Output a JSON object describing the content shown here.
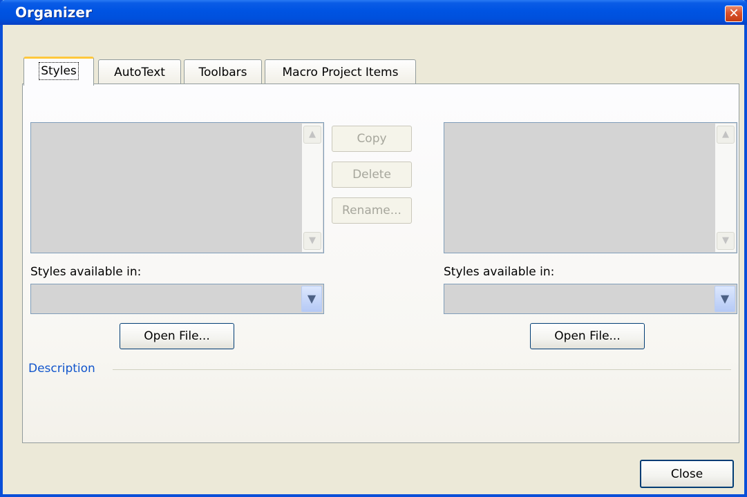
{
  "window": {
    "title": "Organizer",
    "close_glyph": "✕"
  },
  "tabs": [
    {
      "label": "Styles",
      "active": true
    },
    {
      "label": "AutoText",
      "active": false
    },
    {
      "label": "Toolbars",
      "active": false
    },
    {
      "label": "Macro Project Items",
      "active": false
    }
  ],
  "left": {
    "available_label": "Styles available in:",
    "available_value": "",
    "open_file_label": "Open File..."
  },
  "right": {
    "available_label": "Styles available in:",
    "available_value": "",
    "open_file_label": "Open File..."
  },
  "actions": {
    "copy_label": "Copy",
    "delete_label": "Delete",
    "rename_label": "Rename..."
  },
  "description": {
    "label": "Description",
    "text": ""
  },
  "footer": {
    "close_label": "Close"
  },
  "icons": {
    "scroll_up": "▲",
    "scroll_down": "▼",
    "dropdown": "▼"
  },
  "colors": {
    "titlebar": "#0054e3",
    "dialog_bg": "#ece9d8",
    "description_label": "#1155cc",
    "active_tab_highlight": "#ffc83c"
  }
}
